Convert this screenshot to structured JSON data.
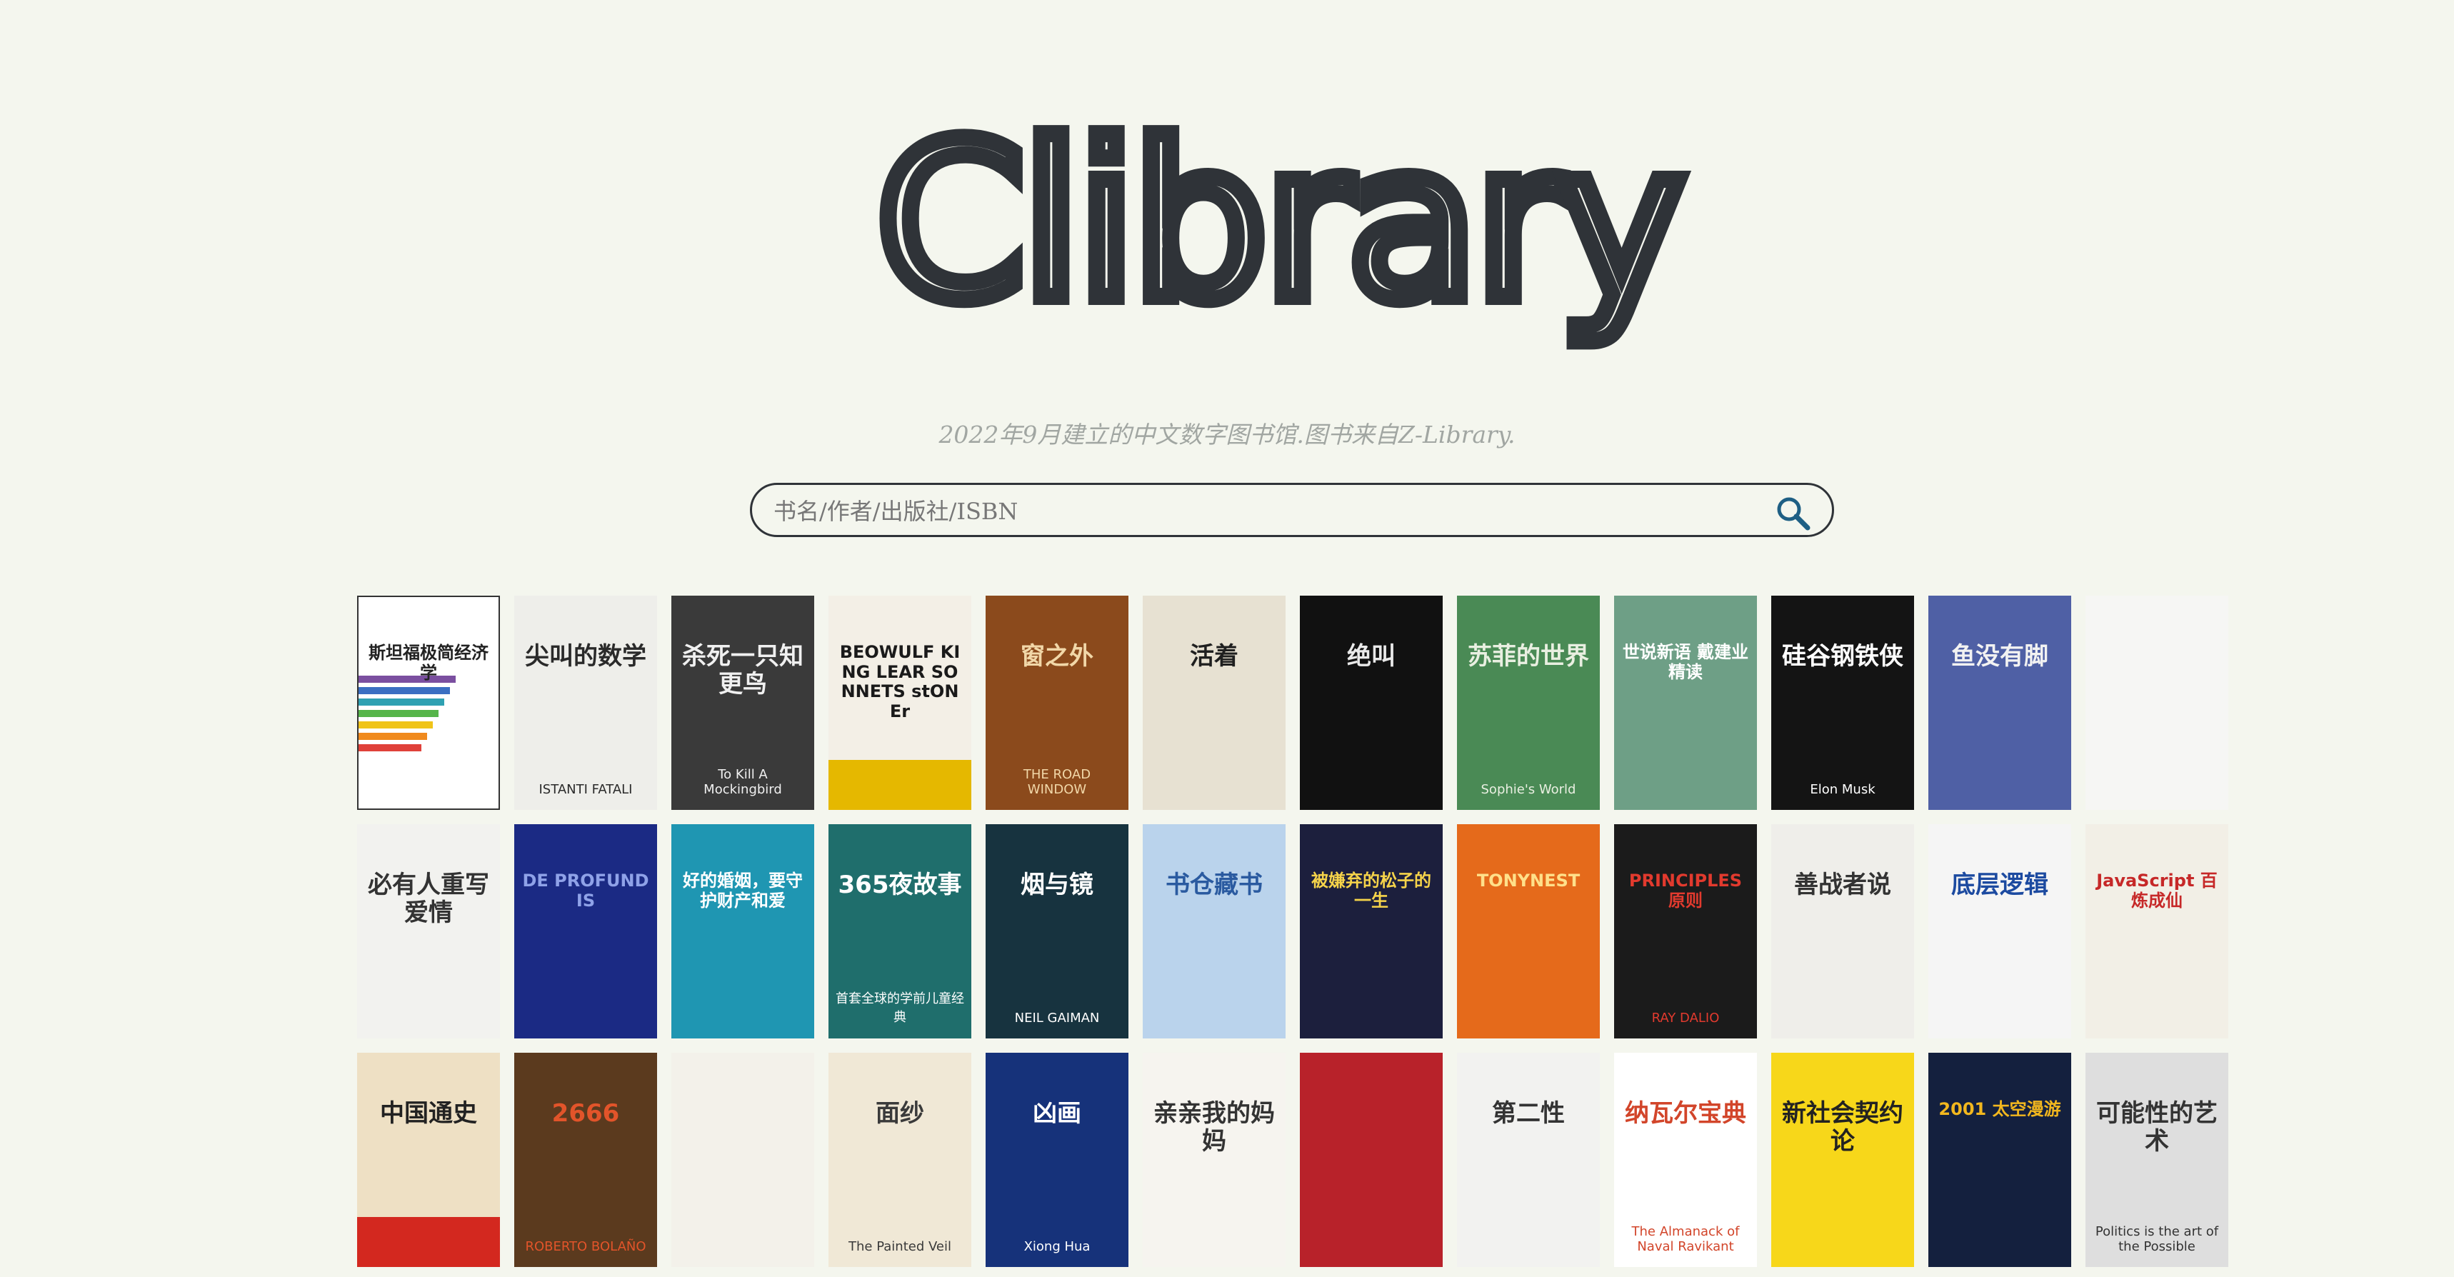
{
  "header": {
    "logo_text": "Clibrary",
    "tagline": "2022年9月建立的中文数字图书馆.图书来自Z-Library."
  },
  "search": {
    "placeholder": "书名/作者/出版社/ISBN",
    "value": "",
    "button_icon": "search-icon"
  },
  "colors": {
    "background": "#f4f6ee",
    "logo": "#2f3338",
    "search_border": "#2f3338",
    "search_icon": "#1e5f84",
    "tagline": "#a1a6a2"
  },
  "books": [
    [
      {
        "title": "斯坦福极简经济学",
        "bg": "#ffffff",
        "fg": "#222222",
        "stripe": "rainbow",
        "border": "#333333"
      },
      {
        "title": "尖叫的数学",
        "subtitle": "ISTANTI FATALI",
        "bg": "#eeeeea",
        "fg": "#2a2a2a"
      },
      {
        "title": "杀死一只知更鸟",
        "subtitle": "To Kill A Mockingbird",
        "bg": "#3a3a3a",
        "fg": "#f0f0f0"
      },
      {
        "title": "BEOWULF KING LEAR SONNETS stONEr",
        "bg": "#f3efe6",
        "fg": "#1a1a1a",
        "stripe": "#e5b800"
      },
      {
        "title": "窗之外",
        "subtitle": "THE ROAD WINDOW",
        "bg": "#8b4a1c",
        "fg": "#f1d7a8"
      },
      {
        "title": "活着",
        "bg": "#e7e1d2",
        "fg": "#1f1f1f"
      },
      {
        "title": "绝叫",
        "bg": "#111111",
        "fg": "#e9e9e9"
      },
      {
        "title": "苏菲的世界",
        "subtitle": "Sophie's World",
        "bg": "#4a8a55",
        "fg": "#e9efe1"
      },
      {
        "title": "世说新语 戴建业精读",
        "bg": "#6e9f86",
        "fg": "#ffffff"
      },
      {
        "title": "硅谷钢铁侠",
        "subtitle": "Elon Musk",
        "bg": "#141414",
        "fg": "#ffffff"
      },
      {
        "title": "鱼没有脚",
        "bg": "#4f60a5",
        "fg": "#f2f2f2"
      },
      {
        "title": "",
        "bg": "#f6f6f4",
        "fg": "#c62828"
      }
    ],
    [
      {
        "title": "必有人重写爱情",
        "bg": "#f2f2ef",
        "fg": "#333333"
      },
      {
        "title": "DE PROFUNDIS",
        "bg": "#1b2a84",
        "fg": "#8fa2e8"
      },
      {
        "title": "好的婚姻，要守护财产和爱",
        "bg": "#1f96b2",
        "fg": "#ffffff"
      },
      {
        "title": "365夜故事",
        "subtitle": "首套全球的学前儿童经典",
        "bg": "#1f6e6c",
        "fg": "#ffffff"
      },
      {
        "title": "烟与镜",
        "subtitle": "NEIL GAIMAN",
        "bg": "#17333f",
        "fg": "#ffffff"
      },
      {
        "title": "书仓藏书",
        "bg": "#bad3ec",
        "fg": "#2a5aa0"
      },
      {
        "title": "被嫌弃的松子的一生",
        "bg": "#1c1f3d",
        "fg": "#f5d34a"
      },
      {
        "title": "TONYNEST",
        "bg": "#e56a1b",
        "fg": "#ffe08a"
      },
      {
        "title": "PRINCIPLES 原则",
        "subtitle": "RAY DALIO",
        "bg": "#1b1b1b",
        "fg": "#e23a2e"
      },
      {
        "title": "善战者说",
        "bg": "#efeeea",
        "fg": "#333333"
      },
      {
        "title": "底层逻辑",
        "bg": "#f5f5f5",
        "fg": "#1c4aa0"
      },
      {
        "title": "JavaScript 百炼成仙",
        "bg": "#f2efe6",
        "fg": "#c62828"
      }
    ],
    [
      {
        "title": "中国通史",
        "bg": "#eee0c4",
        "fg": "#222222",
        "stripe": "#d3281f"
      },
      {
        "title": "2666",
        "subtitle": "ROBERTO BOLAÑO",
        "bg": "#5b3a1e",
        "fg": "#e2542a"
      },
      {
        "title": "",
        "bg": "#f3f1ea",
        "fg": "#333333"
      },
      {
        "title": "面纱",
        "subtitle": "The Painted Veil",
        "bg": "#f0e8d6",
        "fg": "#3a3a3a"
      },
      {
        "title": "凶画",
        "subtitle": "Xiong Hua",
        "bg": "#16327a",
        "fg": "#ffffff"
      },
      {
        "title": "亲亲我的妈妈",
        "bg": "#f6f4ef",
        "fg": "#333333"
      },
      {
        "title": "",
        "bg": "#b8222a",
        "fg": "#ffffff"
      },
      {
        "title": "第二性",
        "bg": "#f2f2f0",
        "fg": "#333333"
      },
      {
        "title": "纳瓦尔宝典",
        "subtitle": "The Almanack of Naval Ravikant",
        "bg": "#ffffff",
        "fg": "#d2452a"
      },
      {
        "title": "新社会契约论",
        "bg": "#f7d71a",
        "fg": "#222222"
      },
      {
        "title": "2001 太空漫游",
        "bg": "#14203e",
        "fg": "#f2b71e"
      },
      {
        "title": "可能性的艺术",
        "subtitle": "Politics is the art of the Possible",
        "bg": "#dedede",
        "fg": "#333333"
      }
    ]
  ]
}
